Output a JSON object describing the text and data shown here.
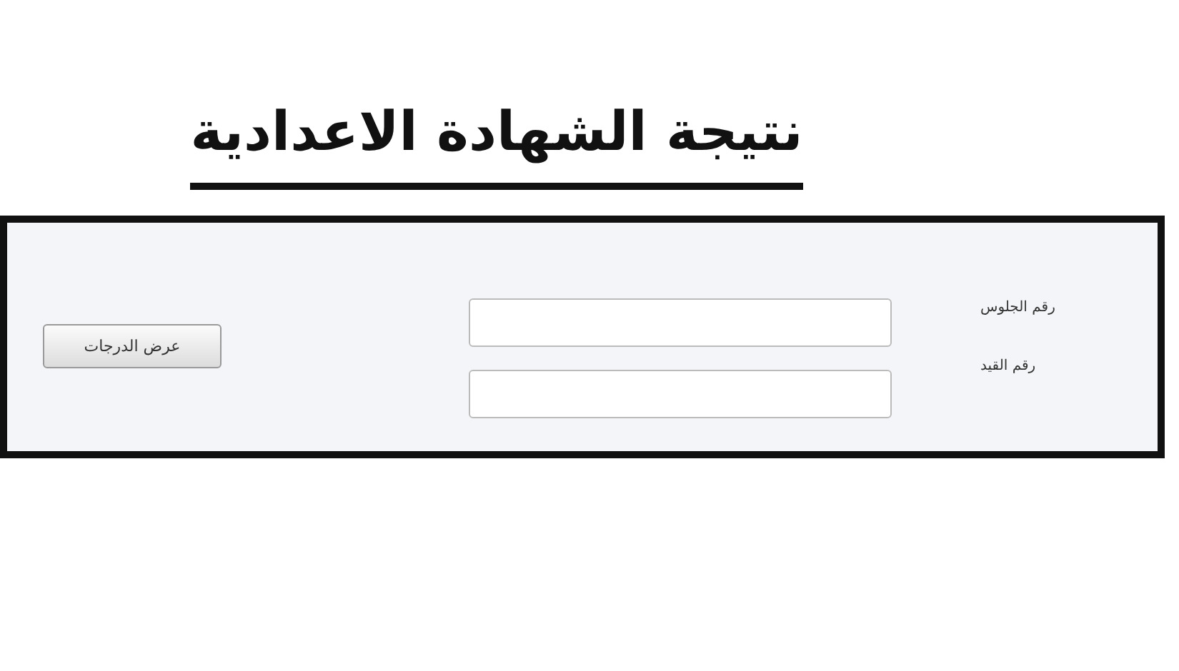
{
  "title": "نتيجة الشهادة الاعدادية",
  "form": {
    "fields": [
      {
        "label": "رقم الجلوس"
      },
      {
        "label": "رقم القيد"
      }
    ],
    "button": "عرض الدرجات"
  }
}
